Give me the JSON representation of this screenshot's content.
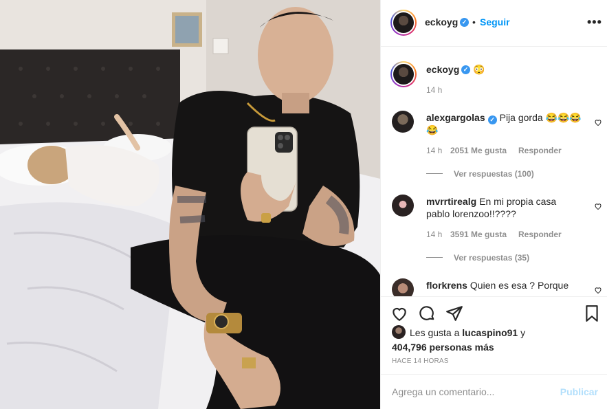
{
  "post_author": {
    "username": "eckoyg",
    "follow_label": "Seguir",
    "dot": "•",
    "more": "•••"
  },
  "caption": {
    "username": "eckoyg",
    "text": "😳",
    "time": "14 h"
  },
  "comments": [
    {
      "username": "alexgargolas",
      "verified": true,
      "text_line1": "Pija gorda 😂😂😂",
      "text_line2": "😂",
      "time": "14 h",
      "likes": "2051 Me gusta",
      "reply_label": "Responder",
      "view_replies": "Ver respuestas (100)"
    },
    {
      "username": "mvrrtirealg",
      "verified": false,
      "text_line1": "En mi propia casa",
      "text_line2": "pablo lorenzoo!!????",
      "time": "14 h",
      "likes": "3591 Me gusta",
      "reply_label": "Responder",
      "view_replies": "Ver respuestas (35)"
    },
    {
      "username": "florkrens",
      "verified": false,
      "text_line1": "Quien es esa ? Porque"
    }
  ],
  "likes_summary": {
    "prefix": "Les gusta a",
    "user": "lucaspino91",
    "joiner": "y",
    "count": "404,796 personas más"
  },
  "posted_ago": "HACE 14 HORAS",
  "composer": {
    "placeholder": "Agrega un comentario...",
    "publish_label": "Publicar"
  },
  "colors": {
    "accent": "#0095f6",
    "verified": "#3897f0",
    "muted": "#8e8e8e",
    "publish_disabled": "#b2dffc"
  },
  "icons": [
    "heart-icon",
    "comment-icon",
    "share-icon",
    "bookmark-icon",
    "verified-icon",
    "more-options-icon"
  ]
}
